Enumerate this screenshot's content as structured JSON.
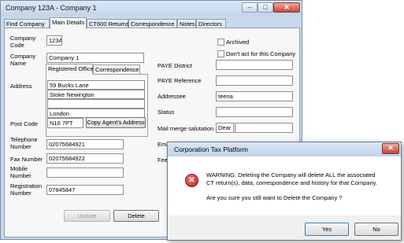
{
  "window": {
    "title": "Company 123A - Company 1",
    "minimize_glyph": "–",
    "maximize_glyph": "□",
    "close_glyph": "✕"
  },
  "tabs": [
    {
      "label": "Find Company"
    },
    {
      "label": "Main Details"
    },
    {
      "label": "CT600 Returns"
    },
    {
      "label": "Correspondence"
    },
    {
      "label": "Notes"
    },
    {
      "label": "Directors"
    }
  ],
  "active_tab": "Main Details",
  "company": {
    "code_label": "Company Code",
    "code_value": "123A",
    "name_label": "Company Name",
    "name_value": "Company 1"
  },
  "address_subtabs": [
    {
      "label": "Registered Office"
    },
    {
      "label": "Correspondence"
    }
  ],
  "address": {
    "label": "Address",
    "lines": [
      "59 Bucks Lane",
      "Stoke Newington",
      "",
      "London"
    ],
    "postcode_label": "Post Code",
    "postcode_value": "N16 7PT",
    "copy_agent_label": "Copy Agent's Address"
  },
  "contact": {
    "telephone_label": "Telephone Number",
    "telephone_value": "02075684921",
    "fax_label": "Fax Number",
    "fax_value": "02075684922",
    "mobile_label": "Mobile Number",
    "mobile_value": "",
    "registration_label": "Registration Number",
    "registration_value": "07845847"
  },
  "right": {
    "archived_label": "Archived",
    "dont_act_label": "Don't act for this Company",
    "paye_district_label": "PAYE District",
    "paye_district_value": "",
    "paye_reference_label": "PAYE Reference",
    "paye_reference_value": "",
    "addressee_label": "Addressee",
    "addressee_value": "teena",
    "status_label": "Status",
    "status_value": "",
    "mail_merge_label": "Mail merge salutation",
    "mail_merge_value": "Dear",
    "email_label_partial": "Email Ad",
    "fee_label_partial": "Fee B"
  },
  "buttons": {
    "update_label": "Update",
    "delete_label": "Delete"
  },
  "dialog": {
    "title": "Corporation Tax Platform",
    "close_glyph": "✕",
    "icon_glyph": "✕",
    "warning_line1": "WARNING: Deleting the Company will delete ALL the associated",
    "warning_line2": "CT return(s), data, correspondence and history for that Company.",
    "question": "Are you sure you still want to Delete the Company ?",
    "yes_label": "Yes",
    "no_label": "No"
  }
}
